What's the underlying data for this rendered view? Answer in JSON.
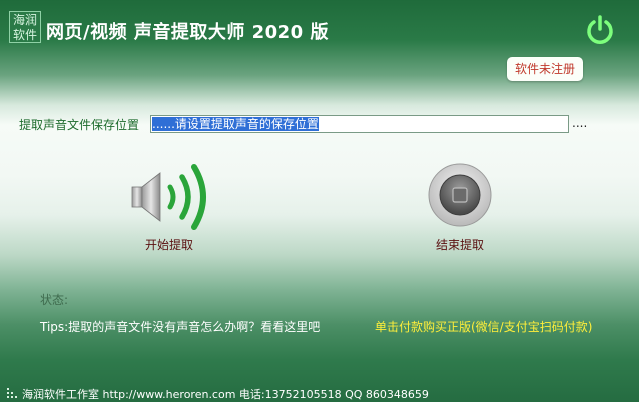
{
  "app": {
    "logo_text": "海润软件",
    "title": "网页/视频 声音提取大师 2020 版",
    "register_badge": "软件未注册"
  },
  "save_path": {
    "label": "提取声音文件保存位置",
    "value": "......请设置提取声音的保存位置",
    "browse_label": "...."
  },
  "controls": {
    "start_label": "开始提取",
    "stop_label": "结束提取"
  },
  "status": {
    "label": "状态:"
  },
  "tips": {
    "text": "Tips:提取的声音文件没有声音怎么办啊？看看这里吧",
    "buy_text": "单击付款购买正版(微信/支付宝扫码付款)"
  },
  "footer": {
    "text": "海润软件工作室 http://www.heroren.com 电话:13752105518  QQ 860348659"
  },
  "colors": {
    "header_green": "#1f6b3b",
    "power_icon": "#7dff7d",
    "badge_text": "#c0392b",
    "start_icon_green": "#2aa53a",
    "buy_link": "#ffef3a"
  },
  "icons": [
    "power-icon",
    "speaker-icon",
    "stop-icon",
    "resize-grip-icon"
  ]
}
